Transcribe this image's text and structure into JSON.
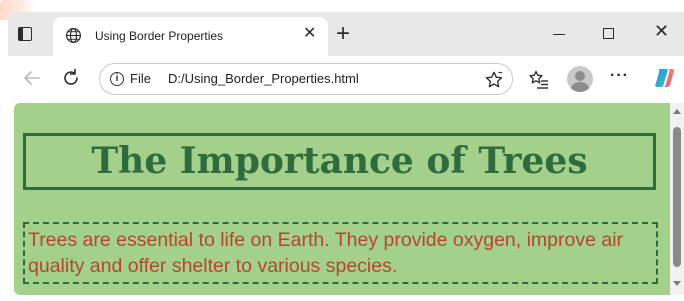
{
  "browser": {
    "tab": {
      "title": "Using Border Properties",
      "close_glyph": "✕",
      "favicon": "globe-icon"
    },
    "new_tab_glyph": "+",
    "window_controls": {
      "close_glyph": "✕"
    },
    "address_bar": {
      "scheme_label": "File",
      "url": "D:/Using_Border_Properties.html",
      "info_glyph": "i"
    },
    "toolbar": {
      "more_glyph": "···"
    }
  },
  "page": {
    "heading": "The Importance of Trees",
    "paragraph": "Trees are essential to life on Earth. They provide oxygen, improve air quality and offer shelter to various species."
  },
  "colors": {
    "page_background": "#a3d08a",
    "heading_color": "#2f6b3d",
    "paragraph_color": "#b5472f",
    "border_color": "#2f6b3d"
  }
}
